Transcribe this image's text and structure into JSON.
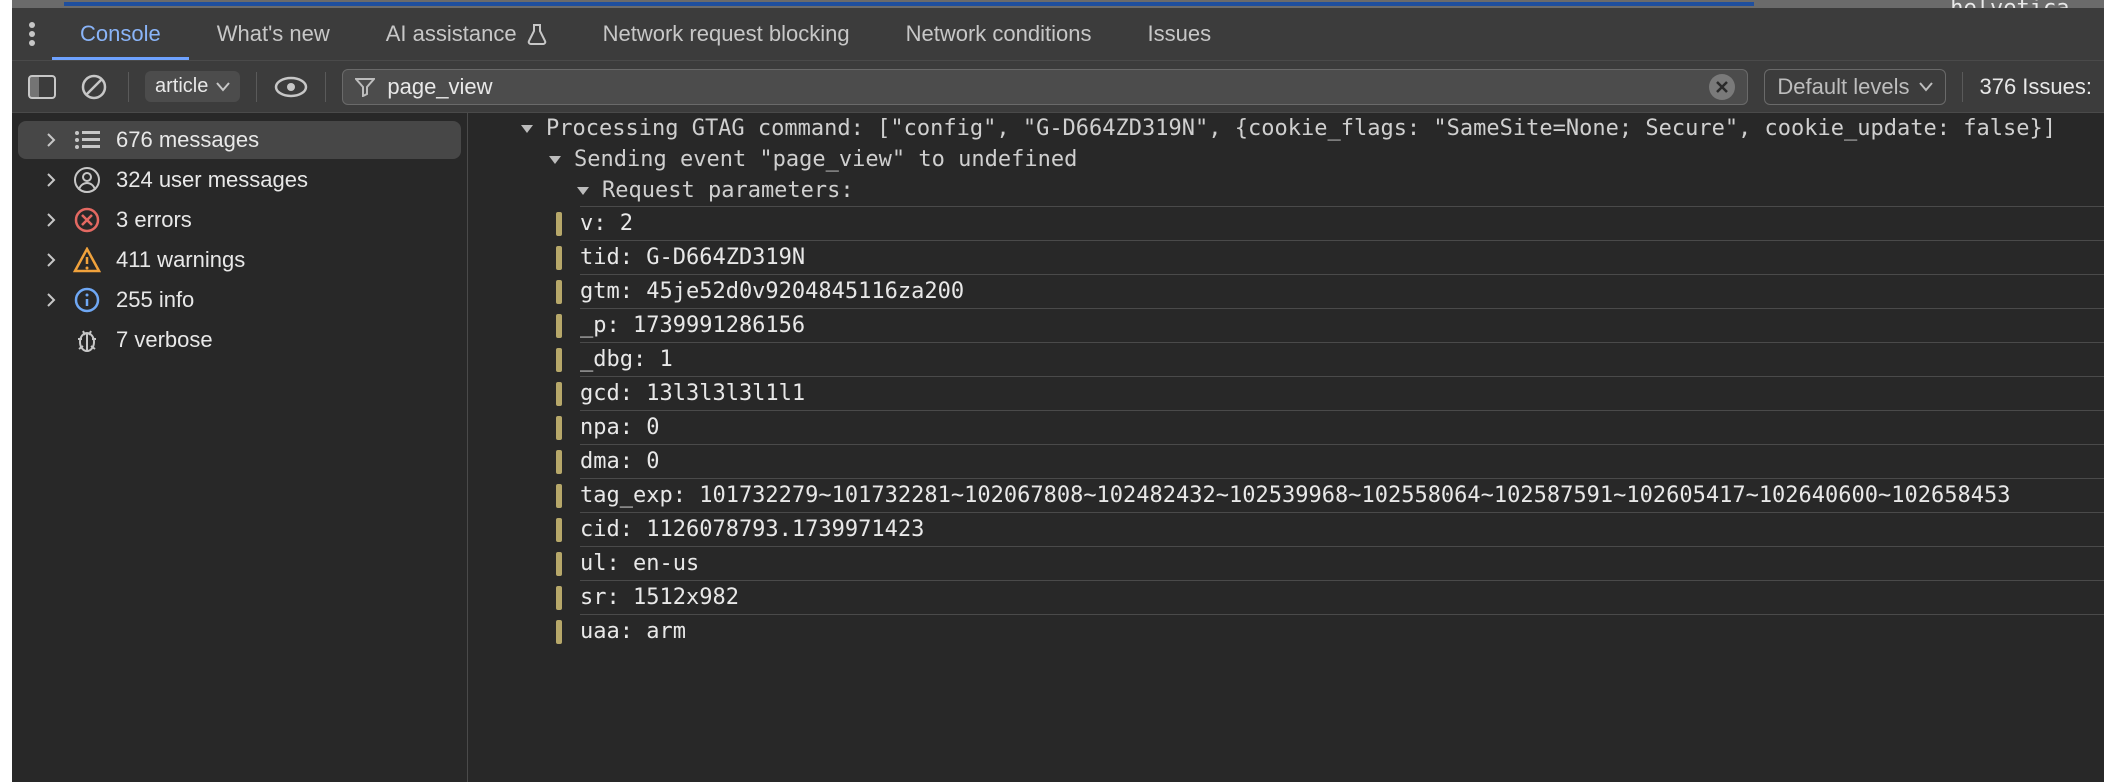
{
  "topRightHint": "helvetica .",
  "tabs": {
    "console": "Console",
    "whatsnew": "What's new",
    "ai": "AI assistance",
    "netreqblock": "Network request blocking",
    "netcond": "Network conditions",
    "issues": "Issues"
  },
  "toolbar": {
    "context": "article",
    "filter_value": "page_view",
    "levels": "Default levels",
    "issues_count": "376 Issues:"
  },
  "sidebar": {
    "messages": "676 messages",
    "user_messages": "324 user messages",
    "errors": "3 errors",
    "warnings": "411 warnings",
    "info": "255 info",
    "verbose": "7 verbose"
  },
  "log": {
    "line1": "Processing GTAG command: [\"config\", \"G-D664ZD319N\", {cookie_flags: \"SameSite=None; Secure\", cookie_update: false}]",
    "line2": "Sending event \"page_view\" to undefined",
    "line3": "Request parameters:",
    "params": [
      "v: 2",
      "tid: G-D664ZD319N",
      "gtm: 45je52d0v9204845116za200",
      "_p: 1739991286156",
      "_dbg: 1",
      "gcd: 13l3l3l3l1l1",
      "npa: 0",
      "dma: 0",
      "tag_exp: 101732279~101732281~102067808~102482432~102539968~102558064~102587591~102605417~102640600~102658453",
      "cid: 1126078793.1739971423",
      "ul: en-us",
      "sr: 1512x982",
      "uaa: arm"
    ]
  }
}
